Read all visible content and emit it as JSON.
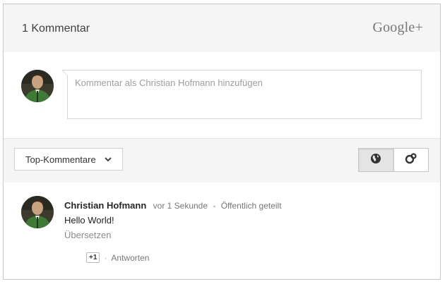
{
  "header": {
    "count_label": "1 Kommentar",
    "brand": "Google+"
  },
  "compose": {
    "placeholder": "Kommentar als Christian Hofmann hinzufügen"
  },
  "toolbar": {
    "sort_label": "Top-Kommentare",
    "sort_icon": "chevron-down-icon",
    "view_options": [
      {
        "icon": "globe-icon",
        "active": true
      },
      {
        "icon": "circles-icon",
        "active": false
      }
    ]
  },
  "comments": [
    {
      "author": "Christian Hofmann",
      "time": "vor 1 Sekunde",
      "separator": "-",
      "visibility": "Öffentlich geteilt",
      "text": "Hello World!",
      "translate": "Übersetzen",
      "plusone": "+1",
      "dot": "·",
      "reply": "Antworten"
    }
  ],
  "colors": {
    "header_bg": "#f5f5f5",
    "border": "#c8c8c8",
    "muted_text": "#9e9e9e"
  }
}
